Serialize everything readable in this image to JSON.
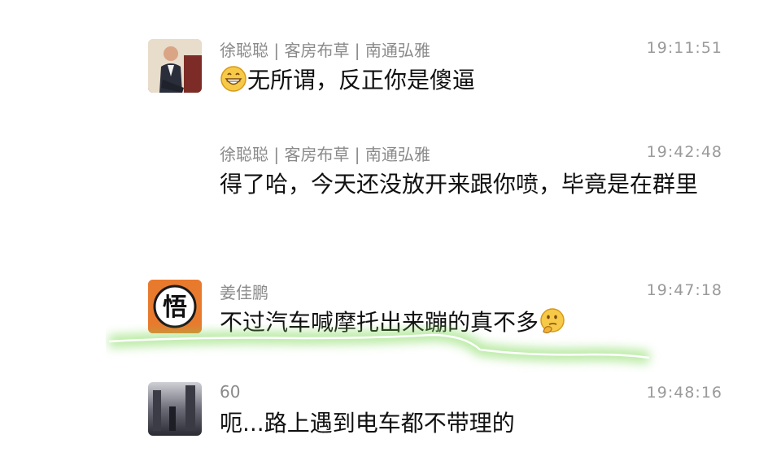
{
  "messages": [
    {
      "sender": "徐聪聪 | 客房布草 | 南通弘雅",
      "time": "19:11:51",
      "text": "无所谓，反正你是傻逼",
      "emoji": "grinning-face-icon"
    },
    {
      "sender": "徐聪聪 | 客房布草 | 南通弘雅",
      "time": "19:42:48",
      "text": "得了哈，今天还没放开来跟你喷，毕竟是在群里"
    },
    {
      "sender": "姜佳鹏",
      "time": "19:47:18",
      "text": "不过汽车喊摩托出来蹦的真不多",
      "emoji": "thinking-face-icon",
      "avatar_char": "悟"
    },
    {
      "sender": "60",
      "time": "19:48:16",
      "text": "呃...路上遇到电车都不带理的"
    }
  ],
  "colors": {
    "highlight": "#7ed957",
    "avatar_orange": "#e87a2e"
  }
}
